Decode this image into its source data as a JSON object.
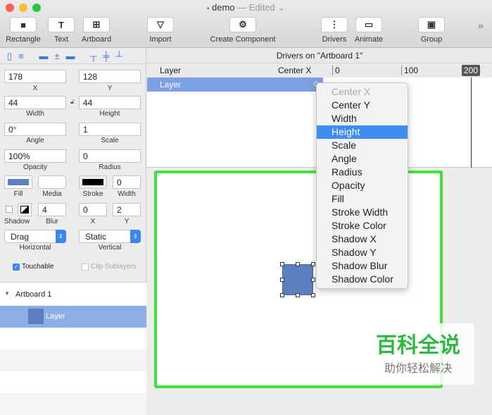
{
  "window": {
    "doc_name": "demo",
    "status": "— Edited ⌄"
  },
  "toolbar": [
    {
      "label": "Rectangle",
      "icon": "■"
    },
    {
      "label": "Text",
      "icon": "T"
    },
    {
      "label": "Artboard",
      "icon": "⊞"
    },
    {
      "label": "Import",
      "icon": "▽"
    },
    {
      "label": "Create Component",
      "icon": "⚙"
    },
    {
      "label": "Drivers",
      "icon": "⋮"
    },
    {
      "label": "Animate",
      "icon": "▭"
    },
    {
      "label": "Group",
      "icon": "▣"
    }
  ],
  "overflow": "»",
  "inspector": {
    "x": "178",
    "x_label": "X",
    "y": "128",
    "y_label": "Y",
    "width": "44",
    "width_label": "Width",
    "height": "44",
    "height_label": "Height",
    "angle": "0°",
    "angle_label": "Angle",
    "scale": "1",
    "scale_label": "Scale",
    "opacity": "100%",
    "opacity_label": "Opacity",
    "radius": "0",
    "radius_label": "Radius",
    "fill_label": "Fill",
    "media_label": "Media",
    "stroke_label": "Stroke",
    "stroke_width": "0",
    "stroke_width_label": "Width",
    "shadow_label": "Shadow",
    "blur": "4",
    "blur_label": "Blur",
    "shadow_x": "0",
    "shadow_x_label": "X",
    "shadow_y": "2",
    "shadow_y_label": "Y",
    "horizontal": "Drag",
    "horizontal_label": "Horizontal",
    "vertical": "Static",
    "vertical_label": "Vertical",
    "touchable": "Touchable",
    "clip": "Clip Sublayers",
    "fill_color": "#5b7fc1"
  },
  "layers": {
    "artboard": "Artboard 1",
    "layer": "Layer"
  },
  "drivers": {
    "title": "Drivers on \"Artboard 1\"",
    "col_layer": "Layer",
    "col_prop": "Center X",
    "row_layer": "Layer",
    "ticks": [
      "0",
      "100"
    ],
    "playhead": "200"
  },
  "menu": [
    "Center X",
    "Center Y",
    "Width",
    "Height",
    "Scale",
    "Angle",
    "Radius",
    "Opacity",
    "Fill",
    "Stroke Width",
    "Stroke Color",
    "Shadow X",
    "Shadow Y",
    "Shadow Blur",
    "Shadow Color"
  ],
  "watermark": {
    "line1": "百科全说",
    "line2": "助你轻松解决"
  }
}
